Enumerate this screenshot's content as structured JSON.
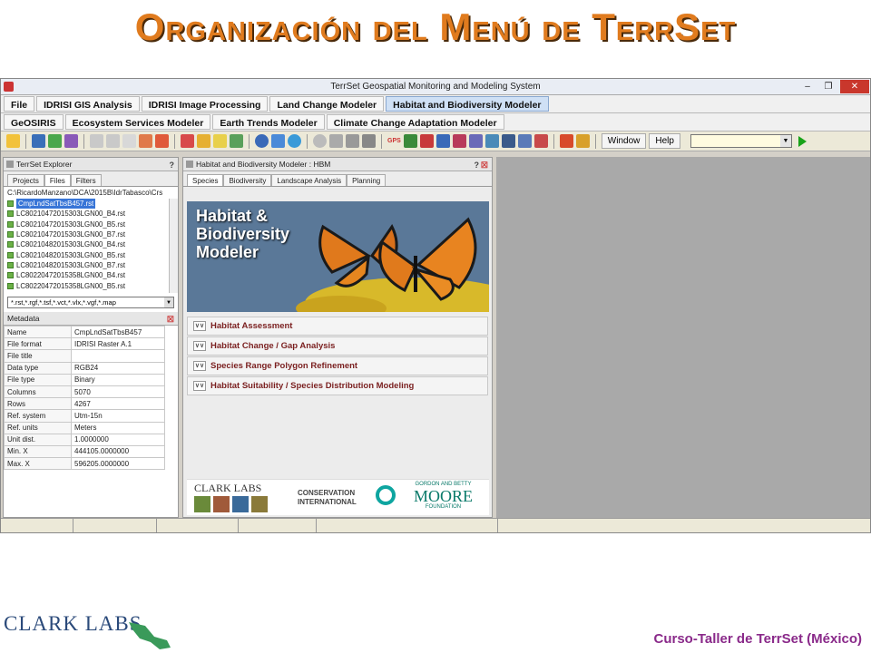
{
  "slide": {
    "title": "Organización del Menú de TerrSet",
    "footer_text": "Curso-Taller de TerrSet (México)",
    "footer_logo": "CLARK LABS"
  },
  "window": {
    "title": "TerrSet Geospatial Monitoring and Modeling System"
  },
  "menu": {
    "row1": [
      "File",
      "IDRISI GIS Analysis",
      "IDRISI Image Processing",
      "Land Change Modeler",
      "Habitat and Biodiversity Modeler"
    ],
    "row2": [
      "GeOSIRIS",
      "Ecosystem Services Modeler",
      "Earth Trends Modeler",
      "Climate Change Adaptation Modeler"
    ],
    "active": "Habitat and Biodiversity Modeler"
  },
  "toolbar": {
    "window_label": "Window",
    "help_label": "Help",
    "gps_label": "GPS"
  },
  "explorer": {
    "title": "TerrSet Explorer",
    "help": "?",
    "tabs": [
      "Projects",
      "Files",
      "Filters"
    ],
    "active_tab": "Files",
    "path": "C:\\RicardoManzano\\DCA\\2015B\\IdrTabasco\\Crs",
    "files": [
      "CmpLndSatTbsB457.rst",
      "LC80210472015303LGN00_B4.rst",
      "LC80210472015303LGN00_B5.rst",
      "LC80210472015303LGN00_B7.rst",
      "LC80210482015303LGN00_B4.rst",
      "LC80210482015303LGN00_B5.rst",
      "LC80210482015303LGN00_B7.rst",
      "LC80220472015358LGN00_B4.rst",
      "LC80220472015358LGN00_B5.rst"
    ],
    "selected_file": "CmpLndSatTbsB457.rst",
    "filter": "*.rst,*.rgf,*.tsf,*.vct,*.vlx,*.vgf,*.map"
  },
  "metadata": {
    "title": "Metadata",
    "rows": [
      [
        "Name",
        "CmpLndSatTbsB457"
      ],
      [
        "File format",
        "IDRISI Raster A.1"
      ],
      [
        "File title",
        ""
      ],
      [
        "Data type",
        "RGB24"
      ],
      [
        "File type",
        "Binary"
      ],
      [
        "Columns",
        "5070"
      ],
      [
        "Rows",
        "4267"
      ],
      [
        "Ref. system",
        "Utm-15n"
      ],
      [
        "Ref. units",
        "Meters"
      ],
      [
        "Unit dist.",
        "1.0000000"
      ],
      [
        "Min. X",
        "444105.0000000"
      ],
      [
        "Max. X",
        "596205.0000000"
      ]
    ]
  },
  "hbm": {
    "title": "Habitat and Biodiversity Modeler : HBM",
    "help": "?",
    "tabs": [
      "Species",
      "Biodiversity",
      "Landscape Analysis",
      "Planning"
    ],
    "active_tab": "Species",
    "hero_line1": "Habitat &",
    "hero_line2": "Biodiversity",
    "hero_line3": "Modeler",
    "sections": [
      "Habitat Assessment",
      "Habitat Change / Gap Analysis",
      "Species Range Polygon Refinement",
      "Habitat Suitability / Species Distribution Modeling"
    ],
    "logo_clark": "CLARK LABS",
    "logo_conservation_1": "CONSERVATION",
    "logo_conservation_2": "INTERNATIONAL",
    "logo_moore_1": "GORDON AND BETTY",
    "logo_moore_2": "MOORE",
    "logo_moore_3": "FOUNDATION"
  }
}
